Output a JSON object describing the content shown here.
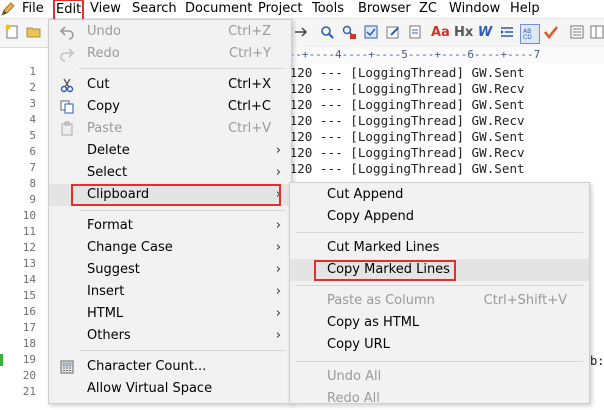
{
  "menubar": {
    "items": [
      "File",
      "Edit",
      "View",
      "Search",
      "Document",
      "Project",
      "Tools",
      "Browser",
      "ZC",
      "Window",
      "Help"
    ]
  },
  "toolbar": {
    "icons": [
      "new-file-icon",
      "open-folder-icon",
      "find-icon",
      "find-replace-icon",
      "spellcheck-icon",
      "html-toolbar-icon",
      "font-icon",
      "heading-icon",
      "italic-w-icon",
      "indent-icon",
      "word-wrap-icon",
      "check-icon",
      "list-icon",
      "panel-icon"
    ]
  },
  "ruler": {
    "text": "---+----4----+----5----+----6----+----7"
  },
  "editor": {
    "line_numbers": [
      "1",
      "2",
      "3",
      "4",
      "5",
      "6",
      "7",
      "8",
      "9",
      "10",
      "11",
      "12",
      "13",
      "14",
      "15",
      "16",
      "17",
      "18",
      "19",
      "20",
      "21"
    ],
    "lines": [
      "2120 --- [LoggingThread] GW.Sent",
      "2120 --- [LoggingThread] GW.Recv",
      "2120 --- [LoggingThread] GW.Sent",
      "2120 --- [LoggingThread] GW.Recv",
      "2120 --- [LoggingThread] GW.Sent",
      "2120 --- [LoggingThread] GW.Recv",
      "2120 --- [LoggingThread] GW.Sent"
    ],
    "line19_tail": "b:"
  },
  "edit_menu": {
    "undo": {
      "label": "Undo",
      "shortcut": "Ctrl+Z"
    },
    "redo": {
      "label": "Redo",
      "shortcut": "Ctrl+Y"
    },
    "cut": {
      "label": "Cut",
      "shortcut": "Ctrl+X"
    },
    "copy": {
      "label": "Copy",
      "shortcut": "Ctrl+C"
    },
    "paste": {
      "label": "Paste",
      "shortcut": "Ctrl+V"
    },
    "delete": {
      "label": "Delete"
    },
    "select": {
      "label": "Select"
    },
    "clipboard": {
      "label": "Clipboard"
    },
    "format": {
      "label": "Format"
    },
    "change_case": {
      "label": "Change Case"
    },
    "suggest": {
      "label": "Suggest"
    },
    "insert": {
      "label": "Insert"
    },
    "html": {
      "label": "HTML"
    },
    "others": {
      "label": "Others"
    },
    "character_count": {
      "label": "Character Count..."
    },
    "allow_virtual_space": {
      "label": "Allow Virtual Space"
    }
  },
  "clipboard_menu": {
    "cut_append": {
      "label": "Cut Append"
    },
    "copy_append": {
      "label": "Copy Append"
    },
    "cut_marked_lines": {
      "label": "Cut Marked Lines"
    },
    "copy_marked_lines": {
      "label": "Copy Marked Lines"
    },
    "paste_as_column": {
      "label": "Paste as Column",
      "shortcut": "Ctrl+Shift+V"
    },
    "copy_as_html": {
      "label": "Copy as HTML"
    },
    "copy_url": {
      "label": "Copy URL"
    },
    "undo_all": {
      "label": "Undo All"
    },
    "redo_all": {
      "label": "Redo All"
    }
  },
  "colors": {
    "highlight_box": "#e0302a",
    "menu_bg": "#f2f2f2",
    "bookmark": "#3cae3c"
  }
}
